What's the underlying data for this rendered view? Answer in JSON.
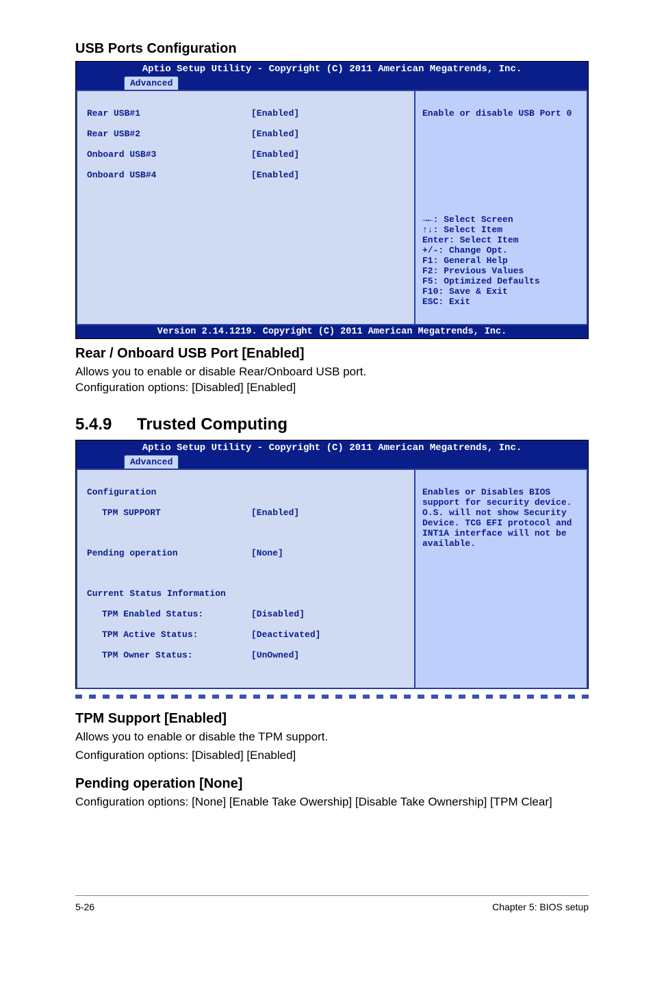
{
  "section1_title": "USB Ports Configuration",
  "bios1": {
    "title": "Aptio Setup Utility - Copyright (C) 2011 American Megatrends, Inc.",
    "tab": "Advanced",
    "rows": [
      {
        "label": "Rear USB#1",
        "value": "[Enabled]"
      },
      {
        "label": "Rear USB#2",
        "value": "[Enabled]"
      },
      {
        "label": "Onboard USB#3",
        "value": "[Enabled]"
      },
      {
        "label": "Onboard USB#4",
        "value": "[Enabled]"
      }
    ],
    "help_top": "Enable or disable USB Port 0",
    "help_keys": "→←: Select Screen\n↑↓:  Select Item\nEnter: Select Item\n+/-: Change Opt.\nF1: General Help\nF2: Previous Values\nF5: Optimized Defaults\nF10: Save & Exit\nESC: Exit",
    "footer": "Version 2.14.1219. Copyright (C) 2011 American Megatrends, Inc."
  },
  "option1_title": "Rear / Onboard USB Port [Enabled]",
  "option1_desc": "Allows you to enable or disable Rear/Onboard USB port.\nConfiguration options: [Disabled] [Enabled]",
  "section2_number": "5.4.9",
  "section2_title": "Trusted Computing",
  "bios2": {
    "title": "Aptio Setup Utility - Copyright (C) 2011 American Megatrends, Inc.",
    "tab": "Advanced",
    "group1_label": "Configuration",
    "rows1": [
      {
        "label": "TPM SUPPORT",
        "value": "[Enabled]"
      }
    ],
    "rows2": [
      {
        "label": "Pending operation",
        "value": "[None]"
      }
    ],
    "group2_label": "Current Status Information",
    "rows3": [
      {
        "label": "TPM Enabled Status:",
        "value": "[Disabled]"
      },
      {
        "label": "TPM Active Status:",
        "value": "[Deactivated]"
      },
      {
        "label": "TPM Owner Status:",
        "value": "[UnOwned]"
      }
    ],
    "help_top": "Enables or Disables BIOS support for security device. O.S. will not show Security Device. TCG EFI protocol and INT1A interface will not be available."
  },
  "option2_title": "TPM Support [Enabled]",
  "option2_desc1": "Allows you to enable or disable the TPM support.",
  "option2_desc2": "Configuration options: [Disabled] [Enabled]",
  "option3_title": "Pending operation [None]",
  "option3_desc": "Configuration options: [None] [Enable Take Owership] [Disable Take Ownership] [TPM Clear]",
  "footer_left": "5-26",
  "footer_right": "Chapter 5: BIOS setup"
}
